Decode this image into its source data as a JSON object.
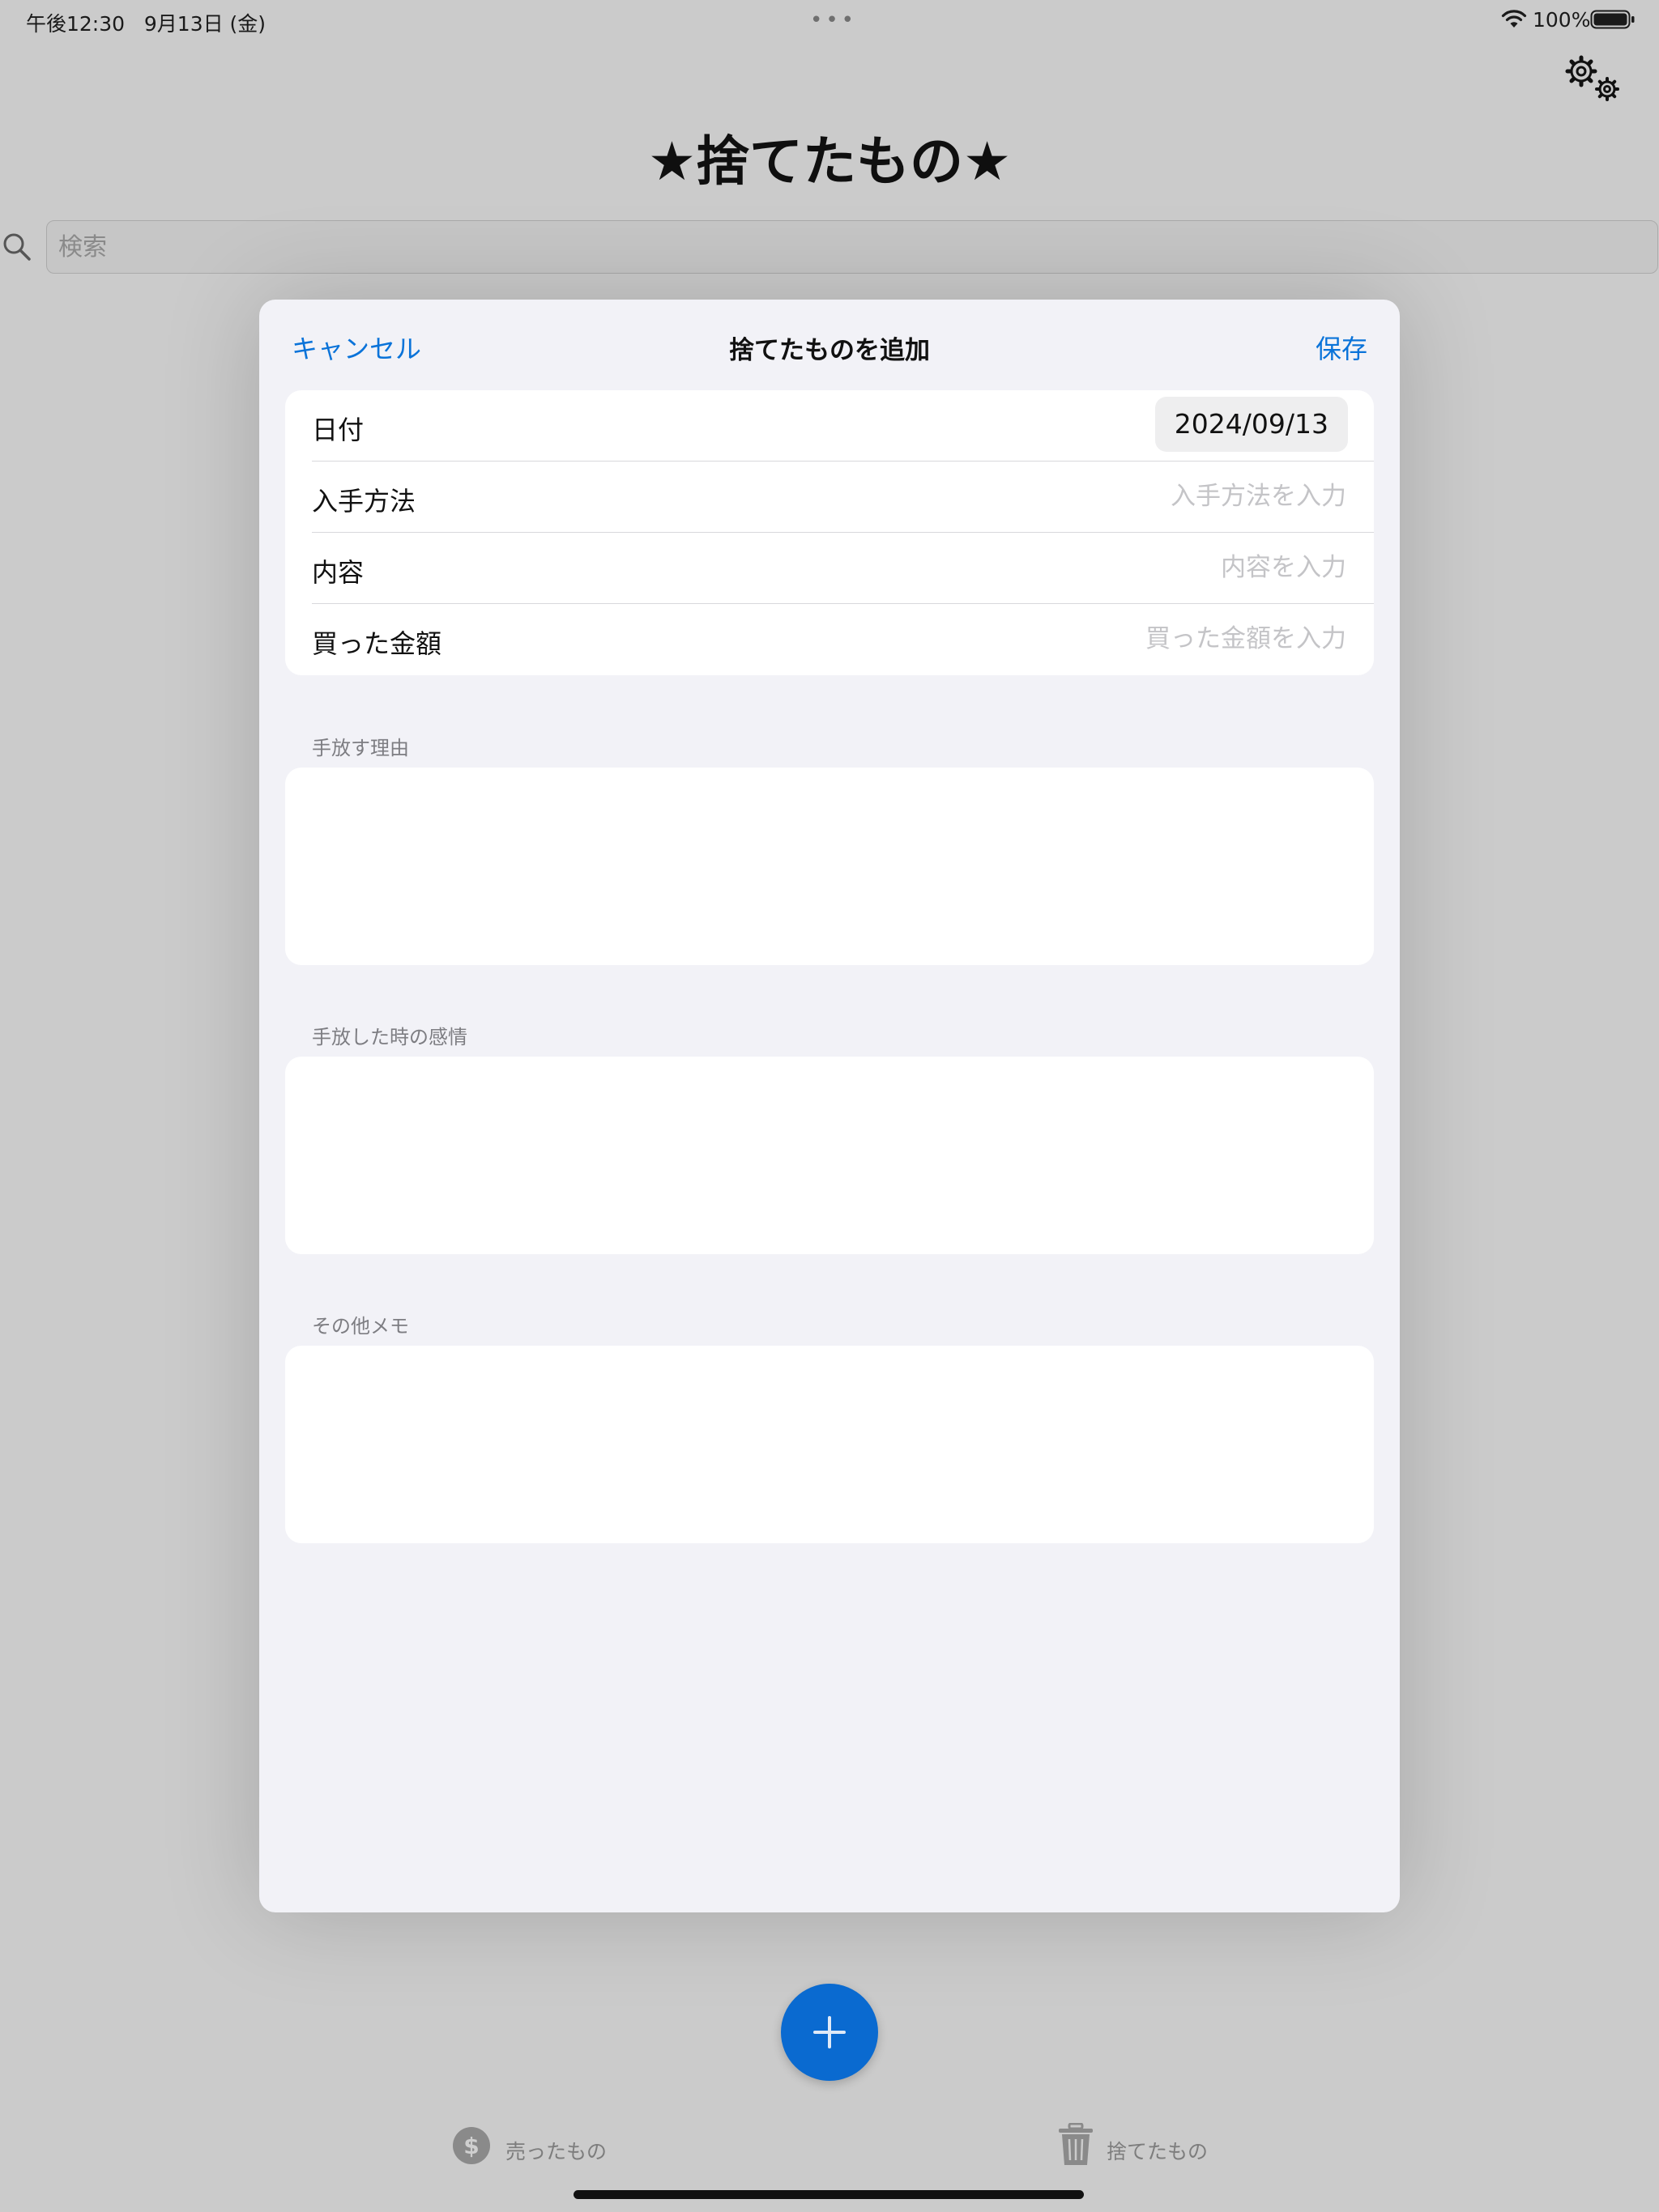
{
  "status_bar": {
    "time": "午後12:30",
    "date": "9月13日 (金)",
    "more_dots": "•••",
    "battery": "100%"
  },
  "header": {
    "title": "★捨てたもの★",
    "settings_icon": "gear-icon"
  },
  "search": {
    "placeholder": "検索",
    "value": ""
  },
  "sheet": {
    "cancel_label": "キャンセル",
    "title": "捨てたものを追加",
    "save_label": "保存",
    "fields": {
      "date": {
        "label": "日付",
        "value": "2024/09/13"
      },
      "source": {
        "label": "入手方法",
        "placeholder": "入手方法を入力",
        "value": ""
      },
      "content": {
        "label": "内容",
        "placeholder": "内容を入力",
        "value": ""
      },
      "price": {
        "label": "買った金額",
        "placeholder": "買った金額を入力",
        "value": ""
      }
    },
    "sections": {
      "reason": {
        "header": "手放す理由",
        "value": ""
      },
      "feeling": {
        "header": "手放した時の感情",
        "value": ""
      },
      "memo": {
        "header": "その他メモ",
        "value": ""
      }
    }
  },
  "fab": {
    "icon": "plus-icon"
  },
  "tabs": {
    "sold": {
      "label": "売ったもの",
      "icon": "dollar-circle-icon"
    },
    "discarded": {
      "label": "捨てたもの",
      "icon": "trash-icon"
    }
  },
  "colors": {
    "accent": "#0a73d9",
    "fab": "#0a6ad0",
    "backdrop": "#cbcbcb",
    "sheet_background": "#f2f2f7"
  }
}
